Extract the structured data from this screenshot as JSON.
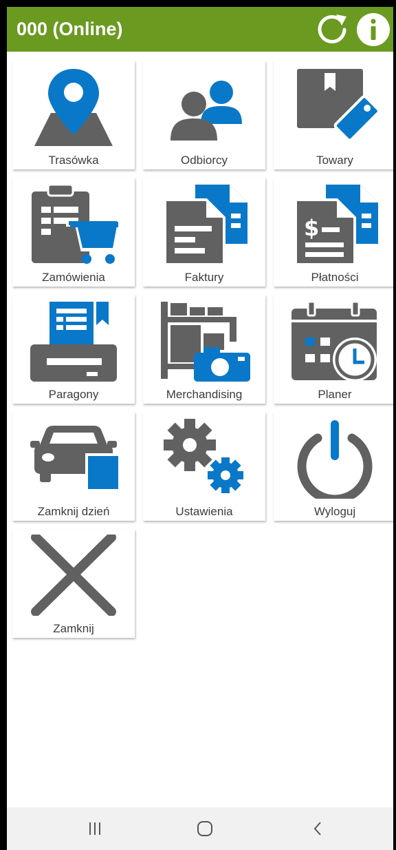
{
  "header": {
    "title": "000 (Online)",
    "background": "#6a9a20"
  },
  "colors": {
    "icon_gray": "#616161",
    "icon_blue": "#0a78c8"
  },
  "menu": {
    "items": [
      {
        "label": "Trasówka",
        "icon": "map-pin-icon"
      },
      {
        "label": "Odbiorcy",
        "icon": "people-icon"
      },
      {
        "label": "Towary",
        "icon": "box-tag-icon"
      },
      {
        "label": "Zamówienia",
        "icon": "clipboard-cart-icon"
      },
      {
        "label": "Faktury",
        "icon": "documents-icon"
      },
      {
        "label": "Płatności",
        "icon": "payment-documents-icon"
      },
      {
        "label": "Paragony",
        "icon": "receipt-printer-icon"
      },
      {
        "label": "Merchandising",
        "icon": "shelf-camera-icon"
      },
      {
        "label": "Planer",
        "icon": "calendar-clock-icon"
      },
      {
        "label": "Zamknij dzień",
        "icon": "car-icon"
      },
      {
        "label": "Ustawienia",
        "icon": "gears-icon"
      },
      {
        "label": "Wyloguj",
        "icon": "power-icon"
      },
      {
        "label": "Zamknij",
        "icon": "close-icon"
      }
    ]
  },
  "navbar": {
    "recents": "recents-icon",
    "home": "home-icon",
    "back": "back-icon"
  }
}
